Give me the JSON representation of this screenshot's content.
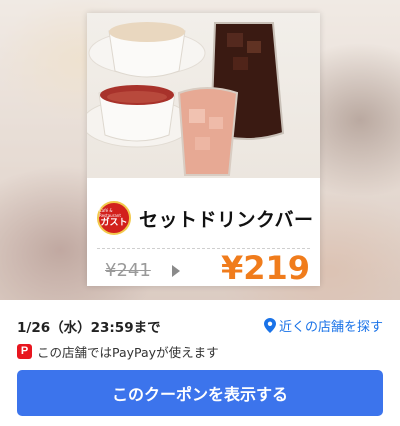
{
  "coupon": {
    "brand_logo_sub": "Café & Restaurant",
    "brand_logo_main": "ガスト",
    "title": "セットドリンクバー",
    "old_price": "¥241",
    "new_price": "¥219"
  },
  "info": {
    "deadline": "1/26（水）23:59まで",
    "nearby_link": "近くの店舗を探す",
    "paypay_note": "この店舗ではPayPayが使えます",
    "paypay_icon_glyph": "P"
  },
  "cta": {
    "label": "このクーポンを表示する"
  },
  "colors": {
    "accent": "#3c74ec",
    "price": "#f07c1c",
    "link": "#1a73e8",
    "paypay": "#e8161f",
    "brand": "#d2201c"
  }
}
